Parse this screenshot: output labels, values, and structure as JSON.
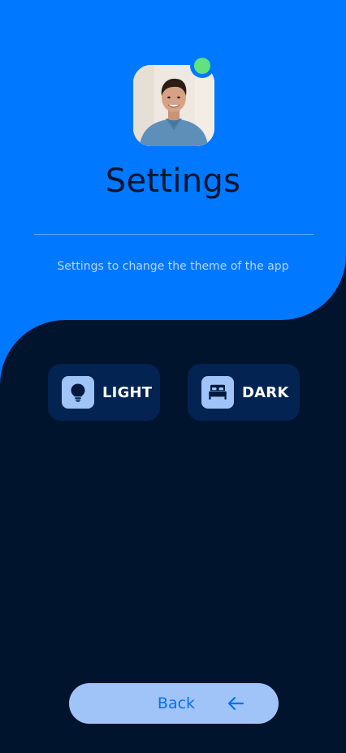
{
  "header": {
    "title": "Settings",
    "subtitle": "Settings to change the theme of the app",
    "avatar_alt": "User profile photo",
    "status": "online"
  },
  "themes": [
    {
      "label": "LIGHT",
      "icon": "lightbulb-icon"
    },
    {
      "label": "DARK",
      "icon": "bed-icon"
    }
  ],
  "footer": {
    "back_label": "Back",
    "back_icon": "arrow-left-icon"
  },
  "colors": {
    "primary": "#0078ff",
    "background": "#00142e",
    "card": "#032452",
    "accent_light": "#a0c4f8",
    "status_online": "#61e27a"
  }
}
